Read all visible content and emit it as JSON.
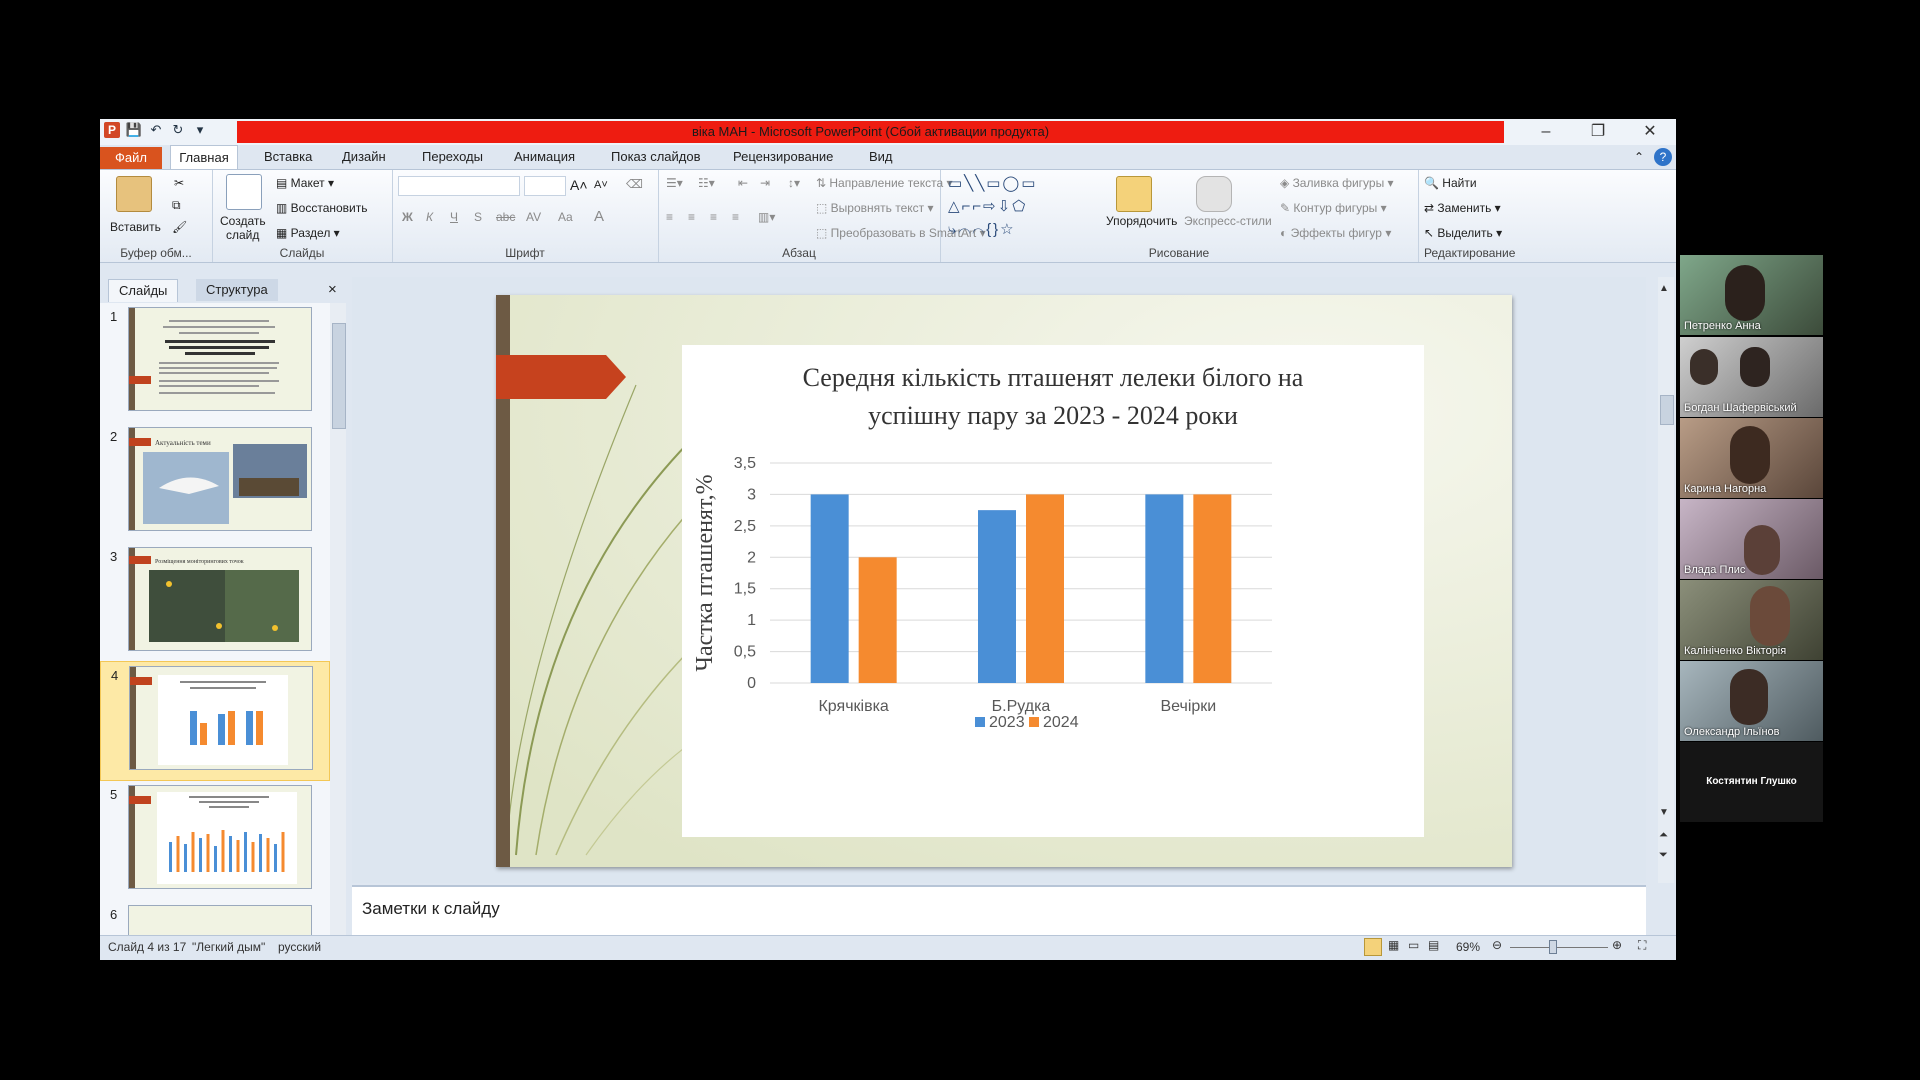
{
  "window": {
    "title": "віка МАН  -  Microsoft PowerPoint (Сбой активации продукта)"
  },
  "ribbon_tabs": [
    "Файл",
    "Главная",
    "Вставка",
    "Дизайн",
    "Переходы",
    "Анимация",
    "Показ слайдов",
    "Рецензирование",
    "Вид"
  ],
  "ribbon": {
    "clipboard": {
      "paste": "Вставить",
      "label": "Буфер обм..."
    },
    "slides": {
      "new_slide_1": "Создать",
      "new_slide_2": "слайд",
      "layout": "Макет",
      "reset": "Восстановить",
      "section": "Раздел",
      "label": "Слайды"
    },
    "font": {
      "label": "Шрифт",
      "bold": "Ж",
      "italic": "К",
      "underline": "Ч",
      "shadow": "S",
      "strike": "abc",
      "spacing": "AV",
      "case": "Aa",
      "color": "A"
    },
    "paragraph": {
      "text_direction": "Направление текста",
      "align_text": "Выровнять текст",
      "smartart": "Преобразовать в SmartArt",
      "label": "Абзац"
    },
    "drawing": {
      "arrange": "Упорядочить",
      "quick_styles": "Экспресс-стили",
      "fill": "Заливка фигуры",
      "outline": "Контур фигуры",
      "effects": "Эффекты фигур",
      "label": "Рисование"
    },
    "editing": {
      "find": "Найти",
      "replace": "Заменить",
      "select": "Выделить",
      "label": "Редактирование"
    }
  },
  "side_panel": {
    "tabs": [
      "Слайды",
      "Структура"
    ],
    "close": "×",
    "slides": [
      {
        "num": "1"
      },
      {
        "num": "2"
      },
      {
        "num": "3"
      },
      {
        "num": "4"
      },
      {
        "num": "5"
      },
      {
        "num": "6"
      }
    ],
    "thumb2_title": "Актуальність теми",
    "thumb3_title": "Розміщення моніторингових точок"
  },
  "slide": {
    "chart_title_line1": "Середня кількість пташенят лелеки білого на",
    "chart_title_line2": "успішну пару за 2023 - 2024 роки"
  },
  "chart_data": {
    "type": "bar",
    "title": "Середня кількість пташенят лелеки білого на успішну пару за 2023 - 2024 роки",
    "xlabel": "",
    "ylabel": "Частка пташенят,%",
    "categories": [
      "Крячківка",
      "Б.Рудка",
      "Вечірки"
    ],
    "series": [
      {
        "name": "2023",
        "values": [
          3,
          2.75,
          3
        ],
        "color": "#4a8fd6"
      },
      {
        "name": "2024",
        "values": [
          2,
          3,
          3
        ],
        "color": "#f58a2f"
      }
    ],
    "ylim": [
      0,
      3.5
    ],
    "yticks": [
      "0",
      "0,5",
      "1",
      "1,5",
      "2",
      "2,5",
      "3",
      "3,5"
    ],
    "grid": true,
    "legend": "bottom"
  },
  "notes": {
    "placeholder": "Заметки к слайду"
  },
  "status": {
    "slide": "Слайд 4 из 17",
    "theme": "\"Легкий дым\"",
    "language": "русский",
    "zoom": "69%"
  },
  "participants": [
    {
      "name": "Петренко Анна"
    },
    {
      "name": "Богдан Шафервіський"
    },
    {
      "name": "Карина Нагорна"
    },
    {
      "name": "Влада Плис"
    },
    {
      "name": "Калініченко Вікторія"
    },
    {
      "name": "Олександр Ільїнов"
    },
    {
      "name": "Костянтин Глушко"
    }
  ],
  "colors": {
    "accent_red": "#ee1c11",
    "file_tab": "#d9531e",
    "series_2023": "#4a8fd6",
    "series_2024": "#f58a2f"
  }
}
